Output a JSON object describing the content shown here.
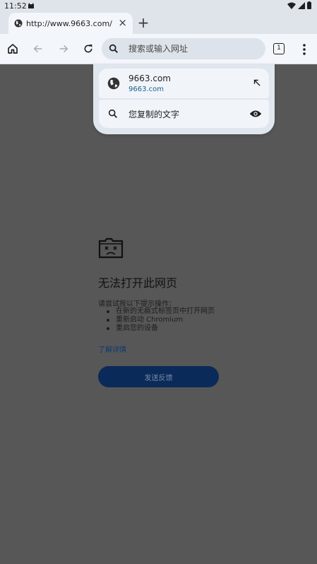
{
  "status_bar": {
    "time": "11:52"
  },
  "tab": {
    "title": "http://www.9663.com/",
    "close_glyph": "×"
  },
  "new_tab_glyph": "+",
  "omnibox": {
    "placeholder": "搜索或输入网址"
  },
  "tab_count": "1",
  "suggestions": [
    {
      "icon": "globe-icon",
      "title": "9663.com",
      "url": "9663.com",
      "trailing_icon": "arrow-up-left-icon"
    },
    {
      "icon": "search-icon",
      "title": "您复制的文字",
      "trailing_icon": "eye-icon"
    }
  ],
  "error_page": {
    "title": "无法打开此网页",
    "hint": "请尝试按以下提示操作：",
    "tips": [
      "在新的无痕式标签页中打开网页",
      "重新启动 Chromium",
      "重启您的设备"
    ],
    "details_link": "了解详情",
    "feedback_button": "发送反馈"
  },
  "colors": {
    "accent": "#0a2a59",
    "link": "#0c3a76",
    "scrim": "#575757"
  }
}
